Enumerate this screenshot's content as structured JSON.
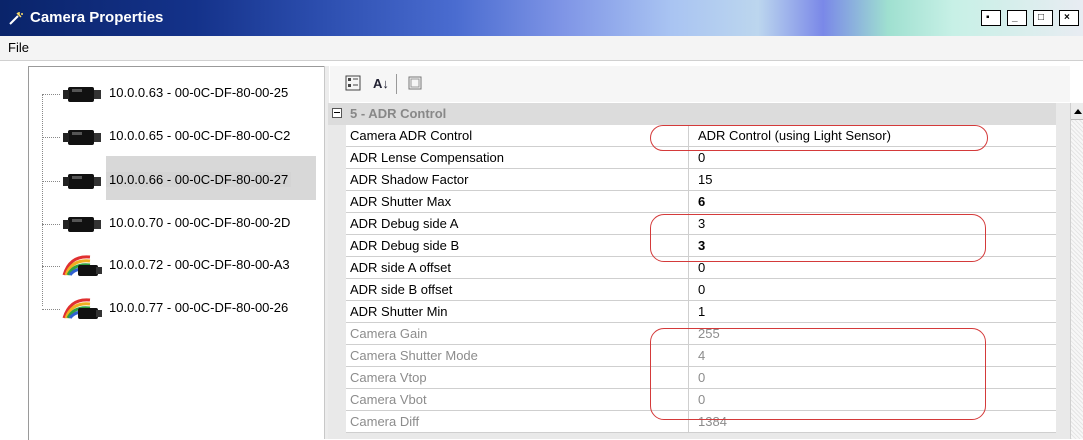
{
  "window": {
    "title": "Camera Properties"
  },
  "menu": {
    "file": "File"
  },
  "tree": {
    "nodes": [
      {
        "label": "10.0.0.63 - 00-0C-DF-80-00-25",
        "icon": "camera-icon",
        "selected": false
      },
      {
        "label": "10.0.0.65 - 00-0C-DF-80-00-C2",
        "icon": "camera-icon",
        "selected": false
      },
      {
        "label": "10.0.0.66 - 00-0C-DF-80-00-27",
        "icon": "camera-icon",
        "selected": true
      },
      {
        "label": "10.0.0.70 - 00-0C-DF-80-00-2D",
        "icon": "camera-icon",
        "selected": false
      },
      {
        "label": "10.0.0.72 - 00-0C-DF-80-00-A3",
        "icon": "color-camera-icon",
        "selected": false
      },
      {
        "label": "10.0.0.77 - 00-0C-DF-80-00-26",
        "icon": "color-camera-icon",
        "selected": false
      }
    ]
  },
  "toolbar": {
    "buttons": [
      "categorized-icon",
      "alphabetical-icon",
      "property-pages-icon"
    ],
    "alpha_glyph": "A↓"
  },
  "grid": {
    "category": "5 - ADR Control",
    "rows": [
      {
        "name": "Camera ADR Control",
        "value": "ADR Control (using Light Sensor)",
        "disabled": false,
        "bold": false
      },
      {
        "name": "ADR Lense Compensation",
        "value": "0",
        "disabled": false,
        "bold": false
      },
      {
        "name": "ADR Shadow Factor",
        "value": "15",
        "disabled": false,
        "bold": false
      },
      {
        "name": "ADR Shutter Max",
        "value": "6",
        "disabled": false,
        "bold": true
      },
      {
        "name": "ADR Debug side A",
        "value": "3",
        "disabled": false,
        "bold": false
      },
      {
        "name": "ADR Debug side B",
        "value": "3",
        "disabled": false,
        "bold": true
      },
      {
        "name": "ADR side A offset",
        "value": "0",
        "disabled": false,
        "bold": false
      },
      {
        "name": "ADR side B offset",
        "value": "0",
        "disabled": false,
        "bold": false
      },
      {
        "name": "ADR Shutter Min",
        "value": "1",
        "disabled": false,
        "bold": false
      },
      {
        "name": "Camera Gain",
        "value": "255",
        "disabled": true,
        "bold": false
      },
      {
        "name": "Camera Shutter Mode",
        "value": "4",
        "disabled": true,
        "bold": false
      },
      {
        "name": "Camera Vtop",
        "value": "0",
        "disabled": true,
        "bold": false
      },
      {
        "name": "Camera Vbot",
        "value": "0",
        "disabled": true,
        "bold": false
      },
      {
        "name": "Camera Diff",
        "value": "1384",
        "disabled": true,
        "bold": false
      }
    ]
  },
  "colors": {
    "annotation": "#d43a3a",
    "title_bar_start": "#0a246a",
    "selection": "#d8d8d8"
  }
}
